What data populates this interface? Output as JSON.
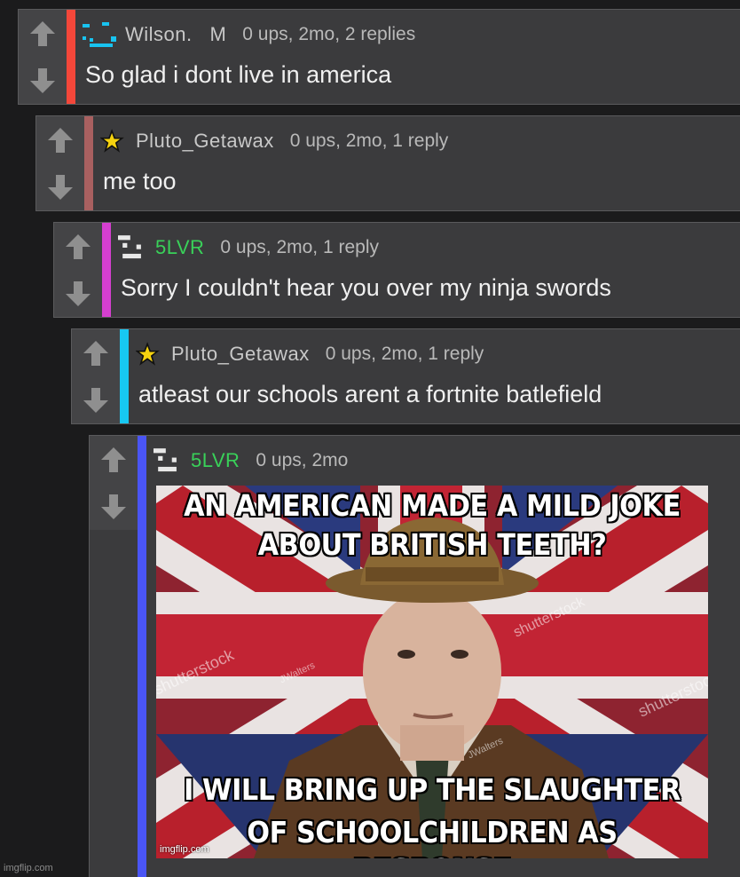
{
  "comments": [
    {
      "username": "Wilson.   M",
      "meta": "0 ups, 2mo, 2 replies",
      "text": "So glad i dont live in america",
      "stripe_color": "#f4473a",
      "avatar": "cyan-face-avatar"
    },
    {
      "username": "Pluto_Getawax",
      "meta": "0 ups, 2mo, 1 reply",
      "text": "me too",
      "stripe_color": "#a96060",
      "avatar": "star-avatar"
    },
    {
      "username": "5LVR",
      "meta": "0 ups, 2mo, 1 reply",
      "text": "Sorry I couldn't hear you over my ninja swords",
      "stripe_color": "#d63fd0",
      "avatar": "pixel-face-avatar"
    },
    {
      "username": "Pluto_Getawax",
      "meta": "0 ups, 2mo, 1 reply",
      "text": "atleast our schools arent a fortnite batlefield",
      "stripe_color": "#17c8f2",
      "avatar": "star-avatar"
    },
    {
      "username": "5LVR",
      "meta": "0 ups, 2mo",
      "stripe_color": "#4a55f5",
      "avatar": "pixel-face-avatar",
      "meme": {
        "top_line1": "AN AMERICAN MADE A MILD JOKE",
        "top_line2": "ABOUT BRITISH TEETH?",
        "bottom_line1": "I WILL BRING UP THE SLAUGHTER",
        "bottom_line2": "OF SCHOOLCHILDREN AS RESPONSE",
        "watermark": "shutterstock",
        "watermark2": "JWalters",
        "credit": "imgflip.com"
      }
    }
  ],
  "site_watermark": "imgflip.com"
}
